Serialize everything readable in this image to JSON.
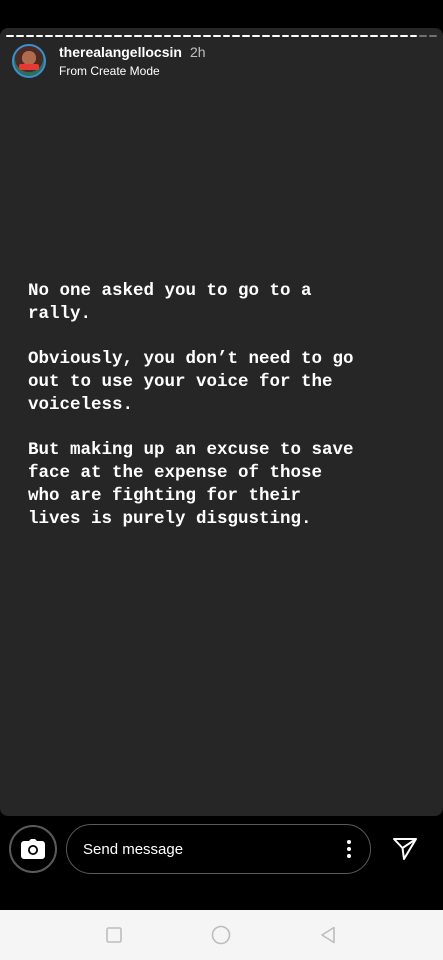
{
  "story": {
    "progress_segments": 44,
    "active_segment": 41,
    "username": "therealangellocsin",
    "time_ago": "2h",
    "subtitle": "From Create Mode",
    "paragraphs": [
      "No one asked you to go to a\nrally.",
      "Obviously, you don’t need to go\nout to use your voice for the\nvoiceless.",
      "But making up an excuse to save\nface at the expense of those\nwho are fighting for their\nlives is purely disgusting."
    ]
  },
  "reply": {
    "placeholder": "Send message",
    "camera_icon": "camera-icon",
    "more_icon": "more-vertical-icon",
    "send_icon": "send-icon"
  },
  "navigation": {
    "recents_icon": "square-recents-icon",
    "home_icon": "circle-home-icon",
    "back_icon": "triangle-back-icon"
  },
  "colors": {
    "story_background": "#262626",
    "avatar_ring": "#3a8fd0",
    "nav_background": "#f5f5f5"
  }
}
